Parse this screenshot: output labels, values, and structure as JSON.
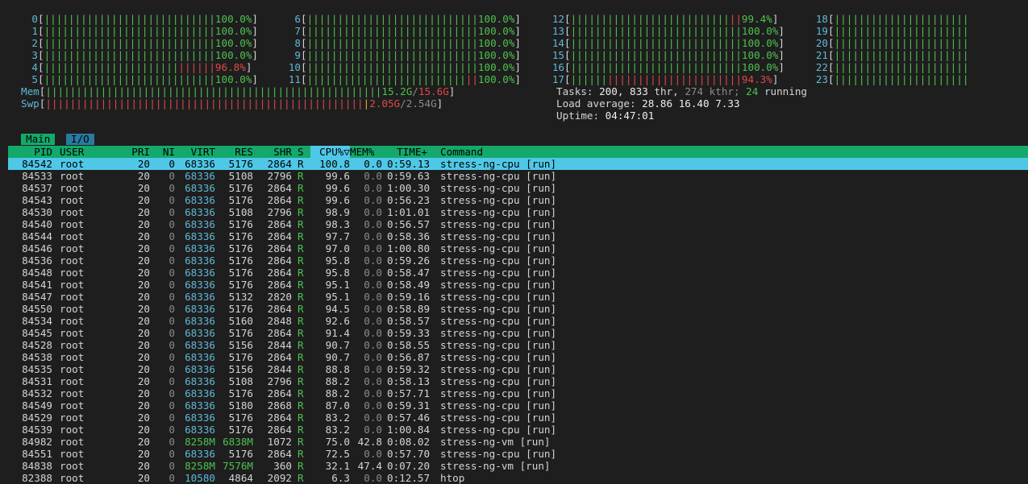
{
  "cpus": [
    {
      "label": "0",
      "pct": "100.0%",
      "red": 0
    },
    {
      "label": "1",
      "pct": "100.0%",
      "red": 0
    },
    {
      "label": "2",
      "pct": "100.0%",
      "red": 0
    },
    {
      "label": "3",
      "pct": "100.0%",
      "red": 0
    },
    {
      "label": "4",
      "pct": "96.8%",
      "red": 6
    },
    {
      "label": "5",
      "pct": "100.0%",
      "red": 0
    },
    {
      "label": "6",
      "pct": "100.0%",
      "red": 0
    },
    {
      "label": "7",
      "pct": "100.0%",
      "red": 0
    },
    {
      "label": "8",
      "pct": "100.0%",
      "red": 0
    },
    {
      "label": "9",
      "pct": "100.0%",
      "red": 0
    },
    {
      "label": "10",
      "pct": "100.0%",
      "red": 0
    },
    {
      "label": "11",
      "pct": "100.0%",
      "red": 2
    },
    {
      "label": "12",
      "pct": "99.4%",
      "red": 2
    },
    {
      "label": "13",
      "pct": "100.0%",
      "red": 0
    },
    {
      "label": "14",
      "pct": "100.0%",
      "red": 0
    },
    {
      "label": "15",
      "pct": "100.0%",
      "red": 0
    },
    {
      "label": "16",
      "pct": "100.0%",
      "red": 0
    },
    {
      "label": "17",
      "pct": "94.3%",
      "red": 22
    },
    {
      "label": "18",
      "pct": "",
      "red": 0
    },
    {
      "label": "19",
      "pct": "",
      "red": 0
    },
    {
      "label": "20",
      "pct": "",
      "red": 0
    },
    {
      "label": "21",
      "pct": "",
      "red": 0
    },
    {
      "label": "22",
      "pct": "",
      "red": 0
    },
    {
      "label": "23",
      "pct": "",
      "red": 0
    }
  ],
  "mem": {
    "label": "Mem",
    "used": "15.2G",
    "total": "15.6G"
  },
  "swp": {
    "label": "Swp",
    "used": "2.05G",
    "total": "2.54G"
  },
  "tasks": {
    "label": "Tasks:",
    "count": "200,",
    "thr": "833",
    "thr_label": "thr,",
    "kthr": "274",
    "kthr_label": "kthr;",
    "running": "24",
    "running_label": "running"
  },
  "load": {
    "label": "Load average:",
    "v1": "28.86",
    "v5": "16.40",
    "v15": "7.33"
  },
  "uptime": {
    "label": "Uptime:",
    "value": "04:47:01"
  },
  "tabs": [
    "Main",
    "I/O"
  ],
  "columns": {
    "pid": "PID",
    "user": "USER",
    "pri": "PRI",
    "ni": "NI",
    "virt": "VIRT",
    "res": "RES",
    "shr": "SHR",
    "s": "S",
    "cpu": "CPU%",
    "sort_arrow": "▽",
    "mem": "MEM%",
    "time": "TIME+",
    "command": "Command"
  },
  "processes": [
    {
      "pid": "84542",
      "user": "root",
      "pri": "20",
      "ni": "0",
      "virt": "68336",
      "res": "5176",
      "shr": "2864",
      "s": "R",
      "cpu": "100.8",
      "mem": "0.0",
      "time": "0:59.13",
      "cmd": "stress-ng-cpu",
      "arg": "[run]",
      "selected": true
    },
    {
      "pid": "84533",
      "user": "root",
      "pri": "20",
      "ni": "0",
      "virt": "68336",
      "res": "5108",
      "shr": "2796",
      "s": "R",
      "cpu": "99.6",
      "mem": "0.0",
      "time": "0:59.63",
      "cmd": "stress-ng-cpu",
      "arg": "[run]"
    },
    {
      "pid": "84537",
      "user": "root",
      "pri": "20",
      "ni": "0",
      "virt": "68336",
      "res": "5176",
      "shr": "2864",
      "s": "R",
      "cpu": "99.6",
      "mem": "0.0",
      "time": "1:00.30",
      "cmd": "stress-ng-cpu",
      "arg": "[run]"
    },
    {
      "pid": "84543",
      "user": "root",
      "pri": "20",
      "ni": "0",
      "virt": "68336",
      "res": "5176",
      "shr": "2864",
      "s": "R",
      "cpu": "99.6",
      "mem": "0.0",
      "time": "0:56.23",
      "cmd": "stress-ng-cpu",
      "arg": "[run]"
    },
    {
      "pid": "84530",
      "user": "root",
      "pri": "20",
      "ni": "0",
      "virt": "68336",
      "res": "5108",
      "shr": "2796",
      "s": "R",
      "cpu": "98.9",
      "mem": "0.0",
      "time": "1:01.01",
      "cmd": "stress-ng-cpu",
      "arg": "[run]"
    },
    {
      "pid": "84540",
      "user": "root",
      "pri": "20",
      "ni": "0",
      "virt": "68336",
      "res": "5176",
      "shr": "2864",
      "s": "R",
      "cpu": "98.3",
      "mem": "0.0",
      "time": "0:56.57",
      "cmd": "stress-ng-cpu",
      "arg": "[run]"
    },
    {
      "pid": "84544",
      "user": "root",
      "pri": "20",
      "ni": "0",
      "virt": "68336",
      "res": "5176",
      "shr": "2864",
      "s": "R",
      "cpu": "97.7",
      "mem": "0.0",
      "time": "0:58.36",
      "cmd": "stress-ng-cpu",
      "arg": "[run]"
    },
    {
      "pid": "84546",
      "user": "root",
      "pri": "20",
      "ni": "0",
      "virt": "68336",
      "res": "5176",
      "shr": "2864",
      "s": "R",
      "cpu": "97.0",
      "mem": "0.0",
      "time": "1:00.80",
      "cmd": "stress-ng-cpu",
      "arg": "[run]"
    },
    {
      "pid": "84536",
      "user": "root",
      "pri": "20",
      "ni": "0",
      "virt": "68336",
      "res": "5176",
      "shr": "2864",
      "s": "R",
      "cpu": "95.8",
      "mem": "0.0",
      "time": "0:59.26",
      "cmd": "stress-ng-cpu",
      "arg": "[run]"
    },
    {
      "pid": "84548",
      "user": "root",
      "pri": "20",
      "ni": "0",
      "virt": "68336",
      "res": "5176",
      "shr": "2864",
      "s": "R",
      "cpu": "95.8",
      "mem": "0.0",
      "time": "0:58.47",
      "cmd": "stress-ng-cpu",
      "arg": "[run]"
    },
    {
      "pid": "84541",
      "user": "root",
      "pri": "20",
      "ni": "0",
      "virt": "68336",
      "res": "5176",
      "shr": "2864",
      "s": "R",
      "cpu": "95.1",
      "mem": "0.0",
      "time": "0:58.49",
      "cmd": "stress-ng-cpu",
      "arg": "[run]"
    },
    {
      "pid": "84547",
      "user": "root",
      "pri": "20",
      "ni": "0",
      "virt": "68336",
      "res": "5132",
      "shr": "2820",
      "s": "R",
      "cpu": "95.1",
      "mem": "0.0",
      "time": "0:59.16",
      "cmd": "stress-ng-cpu",
      "arg": "[run]"
    },
    {
      "pid": "84550",
      "user": "root",
      "pri": "20",
      "ni": "0",
      "virt": "68336",
      "res": "5176",
      "shr": "2864",
      "s": "R",
      "cpu": "94.5",
      "mem": "0.0",
      "time": "0:58.89",
      "cmd": "stress-ng-cpu",
      "arg": "[run]"
    },
    {
      "pid": "84534",
      "user": "root",
      "pri": "20",
      "ni": "0",
      "virt": "68336",
      "res": "5160",
      "shr": "2848",
      "s": "R",
      "cpu": "92.6",
      "mem": "0.0",
      "time": "0:58.57",
      "cmd": "stress-ng-cpu",
      "arg": "[run]"
    },
    {
      "pid": "84545",
      "user": "root",
      "pri": "20",
      "ni": "0",
      "virt": "68336",
      "res": "5176",
      "shr": "2864",
      "s": "R",
      "cpu": "91.4",
      "mem": "0.0",
      "time": "0:59.33",
      "cmd": "stress-ng-cpu",
      "arg": "[run]"
    },
    {
      "pid": "84528",
      "user": "root",
      "pri": "20",
      "ni": "0",
      "virt": "68336",
      "res": "5156",
      "shr": "2844",
      "s": "R",
      "cpu": "90.7",
      "mem": "0.0",
      "time": "0:58.55",
      "cmd": "stress-ng-cpu",
      "arg": "[run]"
    },
    {
      "pid": "84538",
      "user": "root",
      "pri": "20",
      "ni": "0",
      "virt": "68336",
      "res": "5176",
      "shr": "2864",
      "s": "R",
      "cpu": "90.7",
      "mem": "0.0",
      "time": "0:56.87",
      "cmd": "stress-ng-cpu",
      "arg": "[run]"
    },
    {
      "pid": "84535",
      "user": "root",
      "pri": "20",
      "ni": "0",
      "virt": "68336",
      "res": "5156",
      "shr": "2844",
      "s": "R",
      "cpu": "88.8",
      "mem": "0.0",
      "time": "0:59.32",
      "cmd": "stress-ng-cpu",
      "arg": "[run]"
    },
    {
      "pid": "84531",
      "user": "root",
      "pri": "20",
      "ni": "0",
      "virt": "68336",
      "res": "5108",
      "shr": "2796",
      "s": "R",
      "cpu": "88.2",
      "mem": "0.0",
      "time": "0:58.13",
      "cmd": "stress-ng-cpu",
      "arg": "[run]"
    },
    {
      "pid": "84532",
      "user": "root",
      "pri": "20",
      "ni": "0",
      "virt": "68336",
      "res": "5176",
      "shr": "2864",
      "s": "R",
      "cpu": "88.2",
      "mem": "0.0",
      "time": "0:57.71",
      "cmd": "stress-ng-cpu",
      "arg": "[run]"
    },
    {
      "pid": "84549",
      "user": "root",
      "pri": "20",
      "ni": "0",
      "virt": "68336",
      "res": "5180",
      "shr": "2868",
      "s": "R",
      "cpu": "87.0",
      "mem": "0.0",
      "time": "0:59.31",
      "cmd": "stress-ng-cpu",
      "arg": "[run]"
    },
    {
      "pid": "84529",
      "user": "root",
      "pri": "20",
      "ni": "0",
      "virt": "68336",
      "res": "5176",
      "shr": "2864",
      "s": "R",
      "cpu": "83.2",
      "mem": "0.0",
      "time": "0:57.46",
      "cmd": "stress-ng-cpu",
      "arg": "[run]"
    },
    {
      "pid": "84539",
      "user": "root",
      "pri": "20",
      "ni": "0",
      "virt": "68336",
      "res": "5176",
      "shr": "2864",
      "s": "R",
      "cpu": "83.2",
      "mem": "0.0",
      "time": "1:00.84",
      "cmd": "stress-ng-cpu",
      "arg": "[run]"
    },
    {
      "pid": "84982",
      "user": "root",
      "pri": "20",
      "ni": "0",
      "virt": "8258M",
      "res": "6838M",
      "shr": "1072",
      "s": "R",
      "cpu": "75.0",
      "mem": "42.8",
      "time": "0:08.02",
      "cmd": "stress-ng-vm",
      "arg": "[run]"
    },
    {
      "pid": "84551",
      "user": "root",
      "pri": "20",
      "ni": "0",
      "virt": "68336",
      "res": "5176",
      "shr": "2864",
      "s": "R",
      "cpu": "72.5",
      "mem": "0.0",
      "time": "0:57.70",
      "cmd": "stress-ng-cpu",
      "arg": "[run]"
    },
    {
      "pid": "84838",
      "user": "root",
      "pri": "20",
      "ni": "0",
      "virt": "8258M",
      "res": "7576M",
      "shr": "360",
      "s": "R",
      "cpu": "32.1",
      "mem": "47.4",
      "time": "0:07.20",
      "cmd": "stress-ng-vm",
      "arg": "[run]"
    },
    {
      "pid": "82388",
      "user": "root",
      "pri": "20",
      "ni": "0",
      "virt": "10580",
      "res": "4864",
      "shr": "2092",
      "s": "R",
      "cpu": "6.3",
      "mem": "0.0",
      "time": "0:12.57",
      "cmd": "htop",
      "arg": ""
    }
  ],
  "colors": {
    "green": "#4ec24e",
    "red": "#e04848",
    "cyan": "#5fb8d8",
    "header_bg": "#14a96b",
    "selected_bg": "#4fc8e8",
    "background": "#1e1e1e"
  }
}
